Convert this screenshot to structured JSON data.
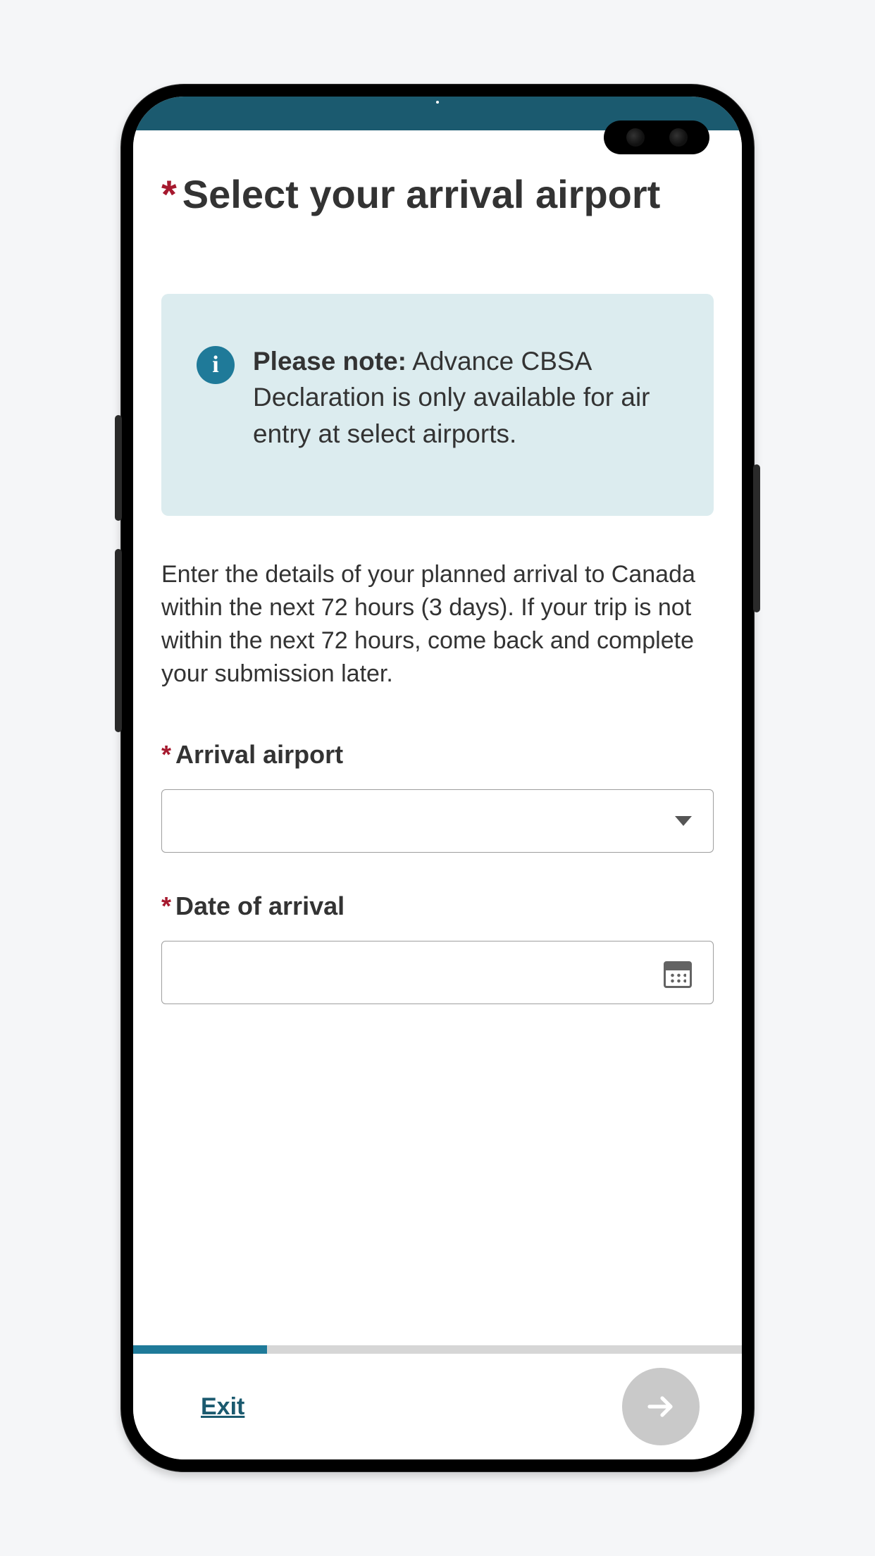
{
  "page": {
    "title": "Select your arrival airport",
    "required_marker": "*"
  },
  "infobox": {
    "lead": "Please note:",
    "body": " Advance CBSA Declaration is only available for air entry at select airports."
  },
  "instructions": "Enter the details of your planned arrival to Canada within the next 72 hours (3 days). If your trip is not within the next 72 hours, come back and complete your submission later.",
  "fields": {
    "airport": {
      "label": "Arrival airport",
      "value": ""
    },
    "date": {
      "label": "Date of arrival",
      "value": ""
    }
  },
  "progress": {
    "percent": 22
  },
  "footer": {
    "exit_label": "Exit"
  }
}
